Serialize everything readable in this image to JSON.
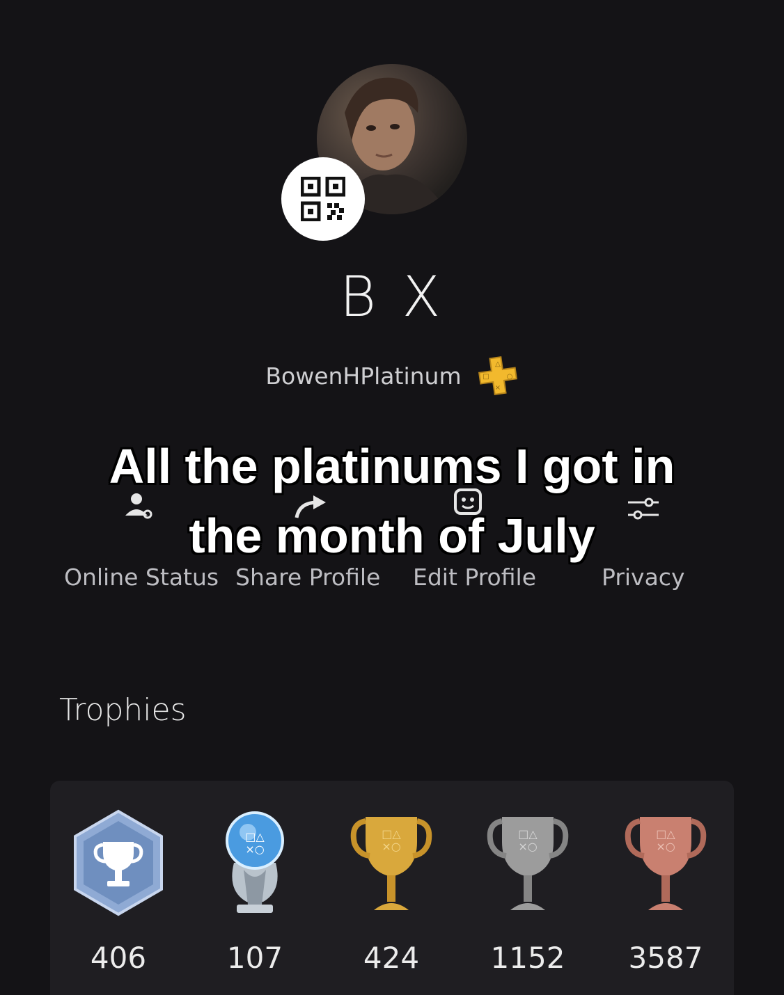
{
  "profile": {
    "display_name": "B X",
    "online_id": "BowenHPlatinum",
    "avatar_icon": "avatar-portrait",
    "qr_icon": "qr-code-icon",
    "membership_icon": "ps-plus-icon"
  },
  "caption": {
    "line1": "All the platinums I got in",
    "line2": "the month of July"
  },
  "actions": [
    {
      "label": "Online Status",
      "icon": "person-status-icon"
    },
    {
      "label": "Share Profile",
      "icon": "share-arrow-icon"
    },
    {
      "label": "Edit Profile",
      "icon": "edit-face-icon"
    },
    {
      "label": "Privacy",
      "icon": "sliders-icon"
    }
  ],
  "trophies": {
    "title": "Trophies",
    "items": [
      {
        "kind": "level",
        "count": "406",
        "color": "#6f8fbf"
      },
      {
        "kind": "platinum",
        "count": "107",
        "color": "#9fd0f2"
      },
      {
        "kind": "gold",
        "count": "424",
        "color": "#d9a83c"
      },
      {
        "kind": "silver",
        "count": "1152",
        "color": "#9c9c9c"
      },
      {
        "kind": "bronze",
        "count": "3587",
        "color": "#c98070"
      }
    ]
  },
  "colors": {
    "background": "#141316",
    "card": "#1f1e22",
    "ps_plus": "#f2b92d"
  }
}
